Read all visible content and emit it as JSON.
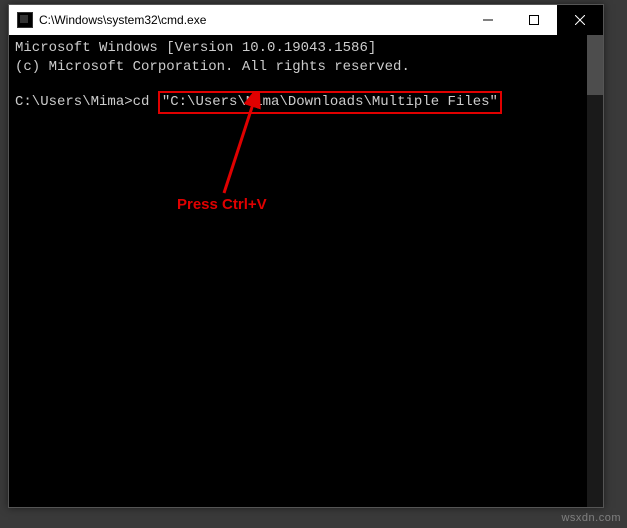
{
  "titlebar": {
    "title": "C:\\Windows\\system32\\cmd.exe"
  },
  "terminal": {
    "line1": "Microsoft Windows [Version 10.0.19043.1586]",
    "line2": "(c) Microsoft Corporation. All rights reserved.",
    "prompt": "C:\\Users\\Mima>",
    "command_prefix": "cd ",
    "command_path": "\"C:\\Users\\Mima\\Downloads\\Multiple Files\""
  },
  "annotation": {
    "hint": "Press Ctrl+V"
  },
  "watermark": "wsxdn.com"
}
